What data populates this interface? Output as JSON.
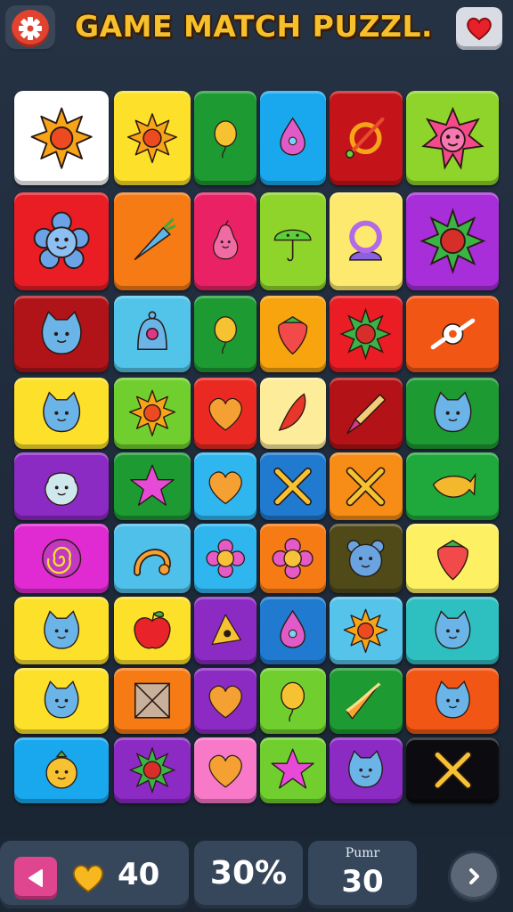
{
  "header": {
    "title": "GAME MATCH PUZZL.",
    "settings_icon": "gear-icon",
    "favorite_icon": "heart-icon"
  },
  "colors": {
    "background": "#222e3e",
    "title": "#f6c02d",
    "panel": "#36475c"
  },
  "board": {
    "rows": 9,
    "cols": 6,
    "tiles": [
      [
        {
          "color": "#ffffff",
          "icon": "sun"
        },
        {
          "color": "#fde02a",
          "icon": "sun"
        },
        {
          "color": "#1e9a33",
          "icon": "balloon"
        },
        {
          "color": "#19a8ee",
          "icon": "drop"
        },
        {
          "color": "#c4141a",
          "icon": "wand"
        },
        {
          "color": "#8fd42a",
          "icon": "spiky-face"
        }
      ],
      [
        {
          "color": "#ea1c24",
          "icon": "flower-face"
        },
        {
          "color": "#f77b14",
          "icon": "carrot"
        },
        {
          "color": "#ea2265",
          "icon": "pear-face"
        },
        {
          "color": "#8fd42a",
          "icon": "mushroom"
        },
        {
          "color": "#fde96e",
          "icon": "ring"
        },
        {
          "color": "#a72ed8",
          "icon": "spiky-ball"
        }
      ],
      [
        {
          "color": "#b01418",
          "icon": "cat-face"
        },
        {
          "color": "#52c4ea",
          "icon": "bell"
        },
        {
          "color": "#1e9a33",
          "icon": "balloon"
        },
        {
          "color": "#f7a40e",
          "icon": "strawberry"
        },
        {
          "color": "#ea1c24",
          "icon": "spiky-ball"
        },
        {
          "color": "#f25614",
          "icon": "candy"
        }
      ],
      [
        {
          "color": "#fde02a",
          "icon": "cat-face"
        },
        {
          "color": "#70cf2e",
          "icon": "sun"
        },
        {
          "color": "#ea2a22",
          "icon": "heart"
        },
        {
          "color": "#fdec9a",
          "icon": "leaf"
        },
        {
          "color": "#b31216",
          "icon": "brush"
        },
        {
          "color": "#1e9a33",
          "icon": "cat-face"
        }
      ],
      [
        {
          "color": "#8c2ac4",
          "icon": "blob-face"
        },
        {
          "color": "#1e9a33",
          "icon": "star"
        },
        {
          "color": "#2fb6ef",
          "icon": "heart"
        },
        {
          "color": "#1f7ad0",
          "icon": "cross"
        },
        {
          "color": "#f78c16",
          "icon": "cross"
        },
        {
          "color": "#1fa83b",
          "icon": "fish"
        }
      ],
      [
        {
          "color": "#e02ad2",
          "icon": "spiral"
        },
        {
          "color": "#4fc0ea",
          "icon": "arc"
        },
        {
          "color": "#2fb6ef",
          "icon": "flower"
        },
        {
          "color": "#f77b14",
          "icon": "flower"
        },
        {
          "color": "#4f4a18",
          "icon": "bear-face"
        },
        {
          "color": "#fdf063",
          "icon": "strawberry"
        }
      ],
      [
        {
          "color": "#fde02a",
          "icon": "cat-face"
        },
        {
          "color": "#fde02a",
          "icon": "apple"
        },
        {
          "color": "#8c2ac4",
          "icon": "cheese"
        },
        {
          "color": "#1f7ad0",
          "icon": "drop"
        },
        {
          "color": "#56c4ea",
          "icon": "sun"
        },
        {
          "color": "#2ec0c0",
          "icon": "cat-face"
        }
      ],
      [
        {
          "color": "#fde02a",
          "icon": "cat-face"
        },
        {
          "color": "#f77b14",
          "icon": "box"
        },
        {
          "color": "#8c2ac4",
          "icon": "heart"
        },
        {
          "color": "#70cf2e",
          "icon": "balloon"
        },
        {
          "color": "#1e9a33",
          "icon": "pizza"
        },
        {
          "color": "#f25614",
          "icon": "cat-face"
        }
      ],
      [
        {
          "color": "#19a8ee",
          "icon": "fruit-face"
        },
        {
          "color": "#8c2ac4",
          "icon": "spiky-ball"
        },
        {
          "color": "#f779c8",
          "icon": "heart"
        },
        {
          "color": "#70cf2e",
          "icon": "star"
        },
        {
          "color": "#8c2ac4",
          "icon": "cat-face"
        },
        {
          "color": "#0c0c10",
          "icon": "cross"
        }
      ]
    ]
  },
  "footer": {
    "back_icon": "triangle-left-icon",
    "lives_icon": "heart-icon",
    "lives": "40",
    "percent": "30%",
    "moves_label": "Pumr",
    "moves": "30",
    "next_icon": "chevron-right-icon"
  }
}
